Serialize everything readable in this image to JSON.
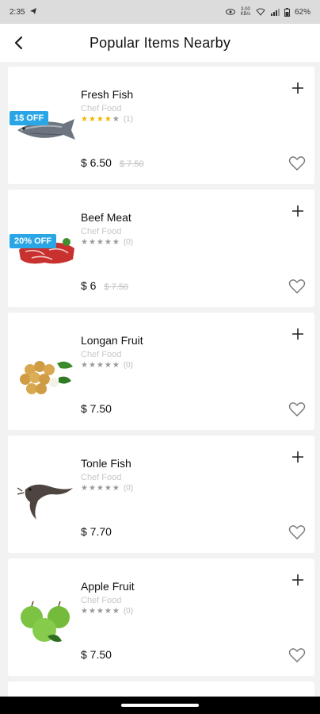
{
  "status_bar": {
    "time": "2:35",
    "net_speed": "3.00\nKB/s",
    "battery": "62%"
  },
  "header": {
    "title": "Popular Items Nearby"
  },
  "items": [
    {
      "name": "Fresh Fish",
      "brand": "Chef Food",
      "rating_count": "(1)",
      "stars_filled": 4,
      "price": "$ 6.50",
      "old_price": "$ 7.50",
      "discount": "1$ OFF",
      "image": "fish-image"
    },
    {
      "name": "Beef Meat",
      "brand": "Chef Food",
      "rating_count": "(0)",
      "stars_filled": 0,
      "price": "$ 6",
      "old_price": "$ 7.50",
      "discount": "20% OFF",
      "image": "beef-image"
    },
    {
      "name": "Longan Fruit",
      "brand": "Chef Food",
      "rating_count": "(0)",
      "stars_filled": 0,
      "price": "$ 7.50",
      "old_price": "",
      "discount": "",
      "image": "longan-image"
    },
    {
      "name": "Tonle Fish",
      "brand": "Chef Food",
      "rating_count": "(0)",
      "stars_filled": 0,
      "price": "$ 7.70",
      "old_price": "",
      "discount": "",
      "image": "catfish-image"
    },
    {
      "name": "Apple Fruit",
      "brand": "Chef Food",
      "rating_count": "(0)",
      "stars_filled": 0,
      "price": "$ 7.50",
      "old_price": "",
      "discount": "",
      "image": "apple-image"
    }
  ],
  "colors": {
    "discount": "#2aa6e6",
    "star": "#f2b600",
    "background": "#f2f2f2"
  }
}
